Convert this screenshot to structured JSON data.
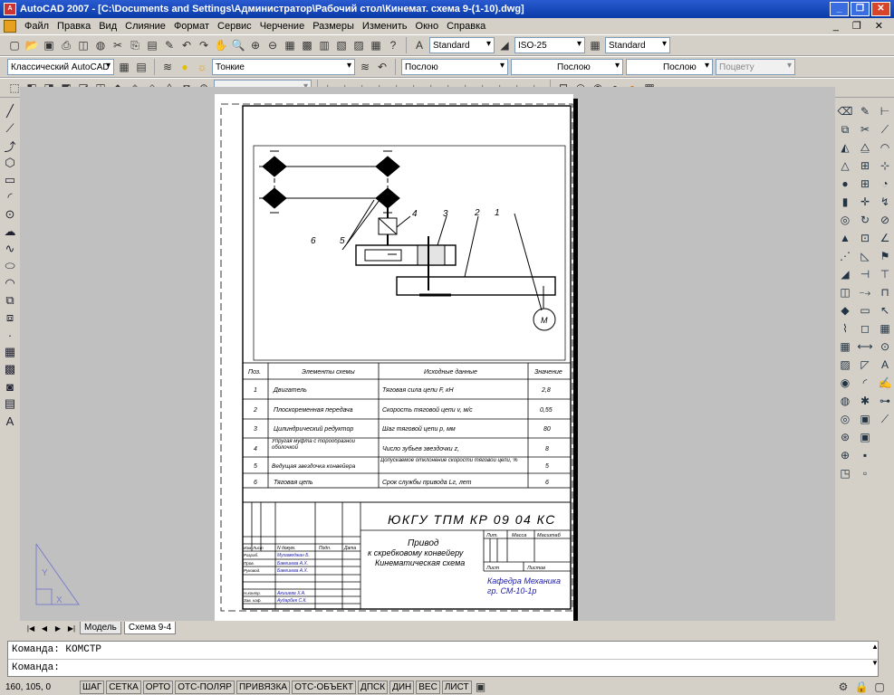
{
  "window": {
    "title": "AutoCAD 2007 - [C:\\Documents and Settings\\Администратор\\Рабочий стол\\Кинемат. схема 9-(1-10).dwg]"
  },
  "menu": [
    "Файл",
    "Правка",
    "Вид",
    "Слияние",
    "Формат",
    "Сервис",
    "Черчение",
    "Размеры",
    "Изменить",
    "Окно",
    "Справка"
  ],
  "toolbar": {
    "text_style": "Standard",
    "dim_style": "ISO-25",
    "table_style": "Standard",
    "workspace": "Классический AutoCAD",
    "layer": "Тонкие",
    "color": "Послою",
    "linetype": "Послою",
    "lineweight": "Послою",
    "plotstyle": "Поцвету"
  },
  "tabs": {
    "model": "Модель",
    "layout": "Схема 9-4"
  },
  "command": {
    "line1": "Команда: КОМСТР",
    "line2": "Команда:"
  },
  "status": {
    "coords": "160, 105, 0",
    "buttons": [
      "ШАГ",
      "СЕТКА",
      "ОРТО",
      "ОТС-ПОЛЯР",
      "ПРИВЯЗКА",
      "ОТС-ОБЪЕКТ",
      "ДПСК",
      "ДИН",
      "ВЕС",
      "ЛИСТ"
    ]
  },
  "drawing": {
    "callouts": [
      "6",
      "5",
      "4",
      "3",
      "2",
      "1"
    ],
    "motor": "М",
    "table_header": {
      "pos": "Поз.",
      "elements": "Элементы схемы",
      "input": "Исходные данные",
      "value": "Значение"
    },
    "rows": [
      {
        "pos": "1",
        "element": "Двигатель",
        "input": "Тяговая сила цепи F, кН",
        "value": "2,8"
      },
      {
        "pos": "2",
        "element": "Плоскоременная передача",
        "input": "Скорость тяговой цепи v, м/с",
        "value": "0,55"
      },
      {
        "pos": "3",
        "element": "Цилиндрический редуктор",
        "input": "Шаг тяговой цепи p, мм",
        "value": "80"
      },
      {
        "pos": "4",
        "element": "Упругая муфта с торообразной оболочкой",
        "input": "Число зубьев звездочки z,",
        "value": "8"
      },
      {
        "pos": "5",
        "element": "Ведущая звездочка конвейера",
        "input": "Допускаемое отклонение скорости тяговой цепи, %",
        "value": "5"
      },
      {
        "pos": "6",
        "element": "Тяговая цепь",
        "input": "Срок службы привода Lг, лет",
        "value": "6"
      }
    ],
    "stamp": {
      "code": "ЮКГУ ТПМ КР 09 04 КС",
      "title1": "Привод",
      "title2": "к скребковому конвейеру",
      "title3": "Кинематическая схема",
      "lit": "Лит.",
      "mass": "Масса",
      "scale": "Масштаб",
      "sheet": "Лист",
      "sheets": "Листов",
      "dept1": "Кафедра Механика",
      "dept2": "гр. СМ-10-1р",
      "izm": "Изм",
      "list": "Лист",
      "doc": "N докум.",
      "podp": "Подп.",
      "date": "Дата",
      "razrab": "Разраб.",
      "prov": "Пров.",
      "rukov": "Руковод.",
      "nkontr": "Н.контр.",
      "utv": "Зав. каф.",
      "n1": "Мухамеджан Б.",
      "n2": "Бакешева А.Х.",
      "n3": "Бакешева А.Х.",
      "n4": "Акишева Х.А.",
      "n5": "Аударбек С.К."
    }
  }
}
